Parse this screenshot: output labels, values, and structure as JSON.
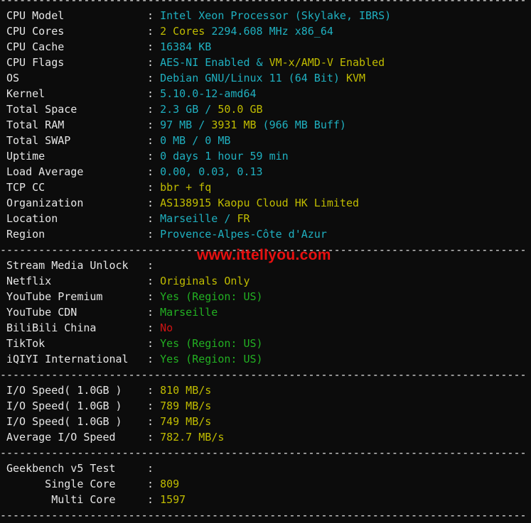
{
  "colors": {
    "cyan": "#1fb0c0",
    "yellow": "#c0bc00",
    "green": "#22b022",
    "red": "#d01414",
    "white": "#e6e6e6",
    "background": "#0c0c0c"
  },
  "separator": "-----------------------------------------------------------------------------------",
  "watermark": "www.ittellyou.com",
  "lines": [
    {
      "type": "sep"
    },
    {
      "label": "CPU Model",
      "segs": [
        {
          "t": "Intel Xeon Processor (Skylake, IBRS)",
          "c": "cyan"
        }
      ]
    },
    {
      "label": "CPU Cores",
      "segs": [
        {
          "t": "2 Cores ",
          "c": "yellow"
        },
        {
          "t": "2294.608 MHz x86_64",
          "c": "cyan"
        }
      ]
    },
    {
      "label": "CPU Cache",
      "segs": [
        {
          "t": "16384 KB",
          "c": "cyan"
        }
      ]
    },
    {
      "label": "CPU Flags",
      "segs": [
        {
          "t": "AES-NI Enabled & ",
          "c": "cyan"
        },
        {
          "t": "VM-x/AMD-V Enabled",
          "c": "yellow"
        }
      ]
    },
    {
      "label": "OS",
      "segs": [
        {
          "t": "Debian GNU/Linux 11 (64 Bit) ",
          "c": "cyan"
        },
        {
          "t": "KVM",
          "c": "yellow"
        }
      ]
    },
    {
      "label": "Kernel",
      "segs": [
        {
          "t": "5.10.0-12-amd64",
          "c": "cyan"
        }
      ]
    },
    {
      "label": "Total Space",
      "segs": [
        {
          "t": "2.3 GB / ",
          "c": "cyan"
        },
        {
          "t": "50.0 GB",
          "c": "yellow"
        }
      ]
    },
    {
      "label": "Total RAM",
      "segs": [
        {
          "t": "97 MB / ",
          "c": "cyan"
        },
        {
          "t": "3931 MB",
          "c": "yellow"
        },
        {
          "t": " (966 MB Buff)",
          "c": "cyan"
        }
      ]
    },
    {
      "label": "Total SWAP",
      "segs": [
        {
          "t": "0 MB / 0 MB",
          "c": "cyan"
        }
      ]
    },
    {
      "label": "Uptime",
      "segs": [
        {
          "t": "0 days 1 hour 59 min",
          "c": "cyan"
        }
      ]
    },
    {
      "label": "Load Average",
      "segs": [
        {
          "t": "0.00, 0.03, 0.13",
          "c": "cyan"
        }
      ]
    },
    {
      "label": "TCP CC",
      "segs": [
        {
          "t": "bbr + fq",
          "c": "yellow"
        }
      ]
    },
    {
      "label": "Organization",
      "segs": [
        {
          "t": "AS138915 Kaopu Cloud HK Limited",
          "c": "yellow"
        }
      ]
    },
    {
      "label": "Location",
      "segs": [
        {
          "t": "Marseille / ",
          "c": "cyan"
        },
        {
          "t": "FR",
          "c": "yellow"
        }
      ]
    },
    {
      "label": "Region",
      "segs": [
        {
          "t": "Provence-Alpes-Côte d'Azur",
          "c": "cyan"
        }
      ]
    },
    {
      "type": "sep"
    },
    {
      "label": "Stream Media Unlock",
      "segs": []
    },
    {
      "label": "Netflix",
      "segs": [
        {
          "t": "Originals Only",
          "c": "yellow"
        }
      ]
    },
    {
      "label": "YouTube Premium",
      "segs": [
        {
          "t": "Yes (Region: US)",
          "c": "green"
        }
      ]
    },
    {
      "label": "YouTube CDN",
      "segs": [
        {
          "t": "Marseille",
          "c": "green"
        }
      ]
    },
    {
      "label": "BiliBili China",
      "segs": [
        {
          "t": "No",
          "c": "red"
        }
      ]
    },
    {
      "label": "TikTok",
      "segs": [
        {
          "t": "Yes (Region: US)",
          "c": "green"
        }
      ]
    },
    {
      "label": "iQIYI International",
      "segs": [
        {
          "t": "Yes (Region: US)",
          "c": "green"
        }
      ]
    },
    {
      "type": "sep"
    },
    {
      "label": "I/O Speed( 1.0GB )",
      "segs": [
        {
          "t": "810 MB/s",
          "c": "yellow"
        }
      ]
    },
    {
      "label": "I/O Speed( 1.0GB )",
      "segs": [
        {
          "t": "789 MB/s",
          "c": "yellow"
        }
      ]
    },
    {
      "label": "I/O Speed( 1.0GB )",
      "segs": [
        {
          "t": "749 MB/s",
          "c": "yellow"
        }
      ]
    },
    {
      "label": "Average I/O Speed",
      "segs": [
        {
          "t": "782.7 MB/s",
          "c": "yellow"
        }
      ]
    },
    {
      "type": "sep"
    },
    {
      "label": "Geekbench v5 Test",
      "segs": []
    },
    {
      "label": "      Single Core",
      "segs": [
        {
          "t": "809",
          "c": "yellow"
        }
      ]
    },
    {
      "label": "       Multi Core",
      "segs": [
        {
          "t": "1597",
          "c": "yellow"
        }
      ]
    },
    {
      "type": "sep"
    }
  ]
}
